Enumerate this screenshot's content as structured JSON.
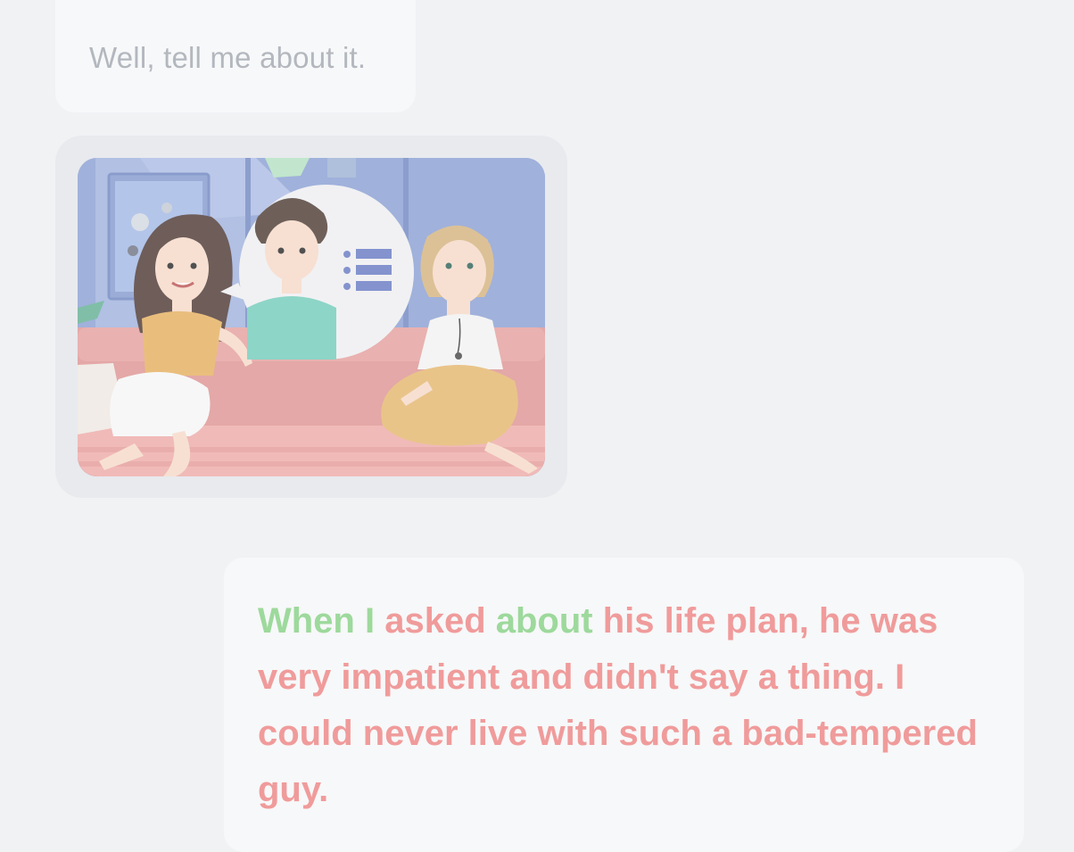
{
  "messages": [
    {
      "id": "incoming-1",
      "text": "Well, tell me about it."
    },
    {
      "id": "incoming-2",
      "image": "illustration of two women on a sofa with a speech bubble showing a man and a list icon"
    },
    {
      "id": "outgoing-1",
      "segments": [
        {
          "text": "When I ",
          "tone": "neutral"
        },
        {
          "text": "asked ",
          "tone": "negative"
        },
        {
          "text": "about ",
          "tone": "neutral"
        },
        {
          "text": "his life plan, he was very impatient and didn't say a thing. I could never live with such a bad-tempered guy.",
          "tone": "negative"
        }
      ]
    }
  ],
  "colors": {
    "background": "#f1f2f4",
    "bubble": "#f7f8f9",
    "image_bubble": "#e8eaee",
    "muted_text": "#b3b7be",
    "neutral_green": "#9dd99c",
    "negative_red": "#f09b9b"
  },
  "icons": {
    "list_icon": "list-icon"
  }
}
